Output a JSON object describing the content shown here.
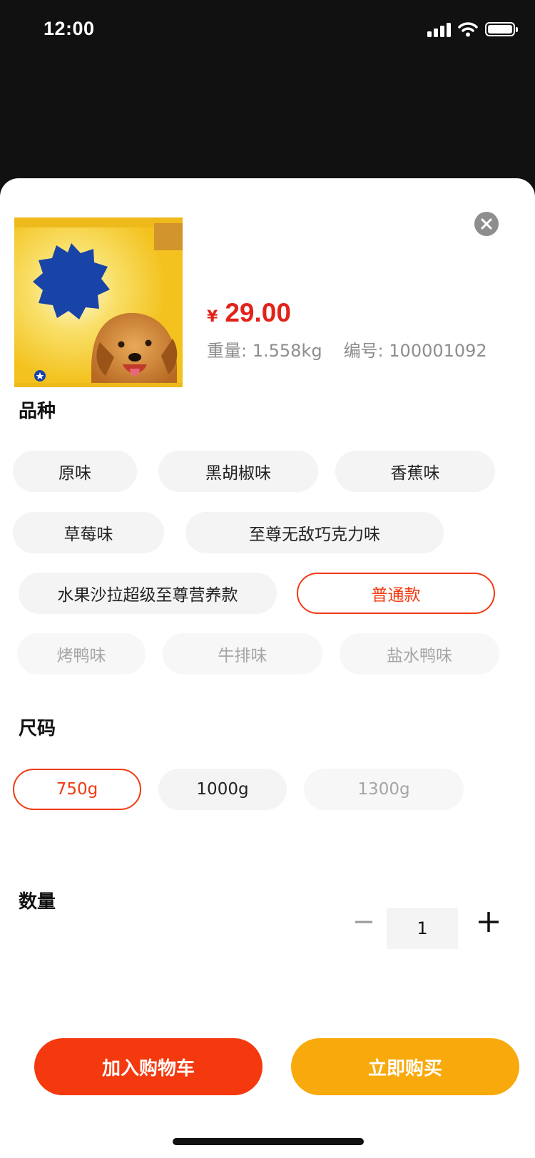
{
  "status_bar": {
    "time": "12:00"
  },
  "product": {
    "brand_logo": "Pedigree",
    "price_currency": "¥",
    "price": "29.00",
    "weight": "重量: 1.558kg",
    "sku": "编号: 100001092"
  },
  "variety": {
    "title": "品种",
    "options": [
      {
        "label": "原味",
        "state": "normal"
      },
      {
        "label": "黑胡椒味",
        "state": "normal"
      },
      {
        "label": "香蕉味",
        "state": "normal"
      },
      {
        "label": "草莓味",
        "state": "normal"
      },
      {
        "label": "至尊无敌巧克力味",
        "state": "normal"
      },
      {
        "label": "水果沙拉超级至尊营养款",
        "state": "normal"
      },
      {
        "label": "普通款",
        "state": "selected"
      },
      {
        "label": "烤鸭味",
        "state": "disabled"
      },
      {
        "label": "牛排味",
        "state": "disabled"
      },
      {
        "label": "盐水鸭味",
        "state": "disabled"
      }
    ]
  },
  "size": {
    "title": "尺码",
    "options": [
      {
        "label": "750g",
        "state": "selected"
      },
      {
        "label": "1000g",
        "state": "normal"
      },
      {
        "label": "1300g",
        "state": "disabled"
      }
    ]
  },
  "quantity": {
    "title": "数量",
    "value": "1"
  },
  "actions": {
    "add_to_cart": "加入购物车",
    "buy_now": "立即购买"
  },
  "colors": {
    "accent": "#f23a11",
    "price": "#e2231a",
    "cart_button": "#f4390e",
    "buy_button": "#f8a90c",
    "chip_bg": "#f4f4f4"
  },
  "icons": [
    "signal-icon",
    "wifi-icon",
    "battery-icon",
    "close-icon",
    "minus-icon",
    "plus-icon"
  ]
}
